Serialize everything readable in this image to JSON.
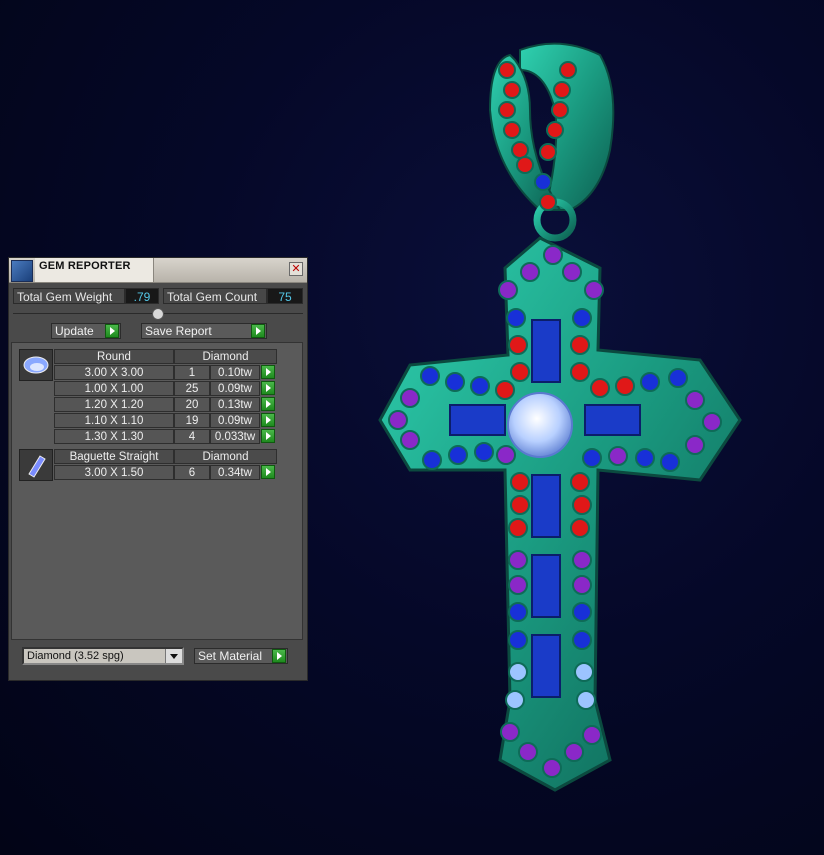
{
  "panel": {
    "title": "GEM REPORTER",
    "close_label": "✕",
    "total_weight_label": "Total Gem Weight",
    "total_weight_value": ".79",
    "total_count_label": "Total Gem Count",
    "total_count_value": "75",
    "update_label": "Update",
    "save_report_label": "Save Report",
    "groups": [
      {
        "shape": "Round",
        "material": "Diamond",
        "icon": "round-gem-icon",
        "rows": [
          {
            "size": "3.00 X 3.00",
            "count": "1",
            "weight": "0.10tw"
          },
          {
            "size": "1.00 X 1.00",
            "count": "25",
            "weight": "0.09tw"
          },
          {
            "size": "1.20 X 1.20",
            "count": "20",
            "weight": "0.13tw"
          },
          {
            "size": "1.10 X 1.10",
            "count": "19",
            "weight": "0.09tw"
          },
          {
            "size": "1.30 X 1.30",
            "count": "4",
            "weight": "0.033tw"
          }
        ]
      },
      {
        "shape": "Baguette Straight",
        "material": "Diamond",
        "icon": "baguette-gem-icon",
        "rows": [
          {
            "size": "3.00 X 1.50",
            "count": "6",
            "weight": "0.34tw"
          }
        ]
      }
    ],
    "material_select": "Diamond    (3.52 spg)",
    "set_material_label": "Set Material"
  },
  "colors": {
    "metal": "#1fa88a",
    "ruby": "#e01818",
    "sapphire": "#1830d8",
    "amethyst": "#8a28c8",
    "aquamarine": "#9cc4ff",
    "value_text": "#54c8e8",
    "background": "#030624"
  }
}
